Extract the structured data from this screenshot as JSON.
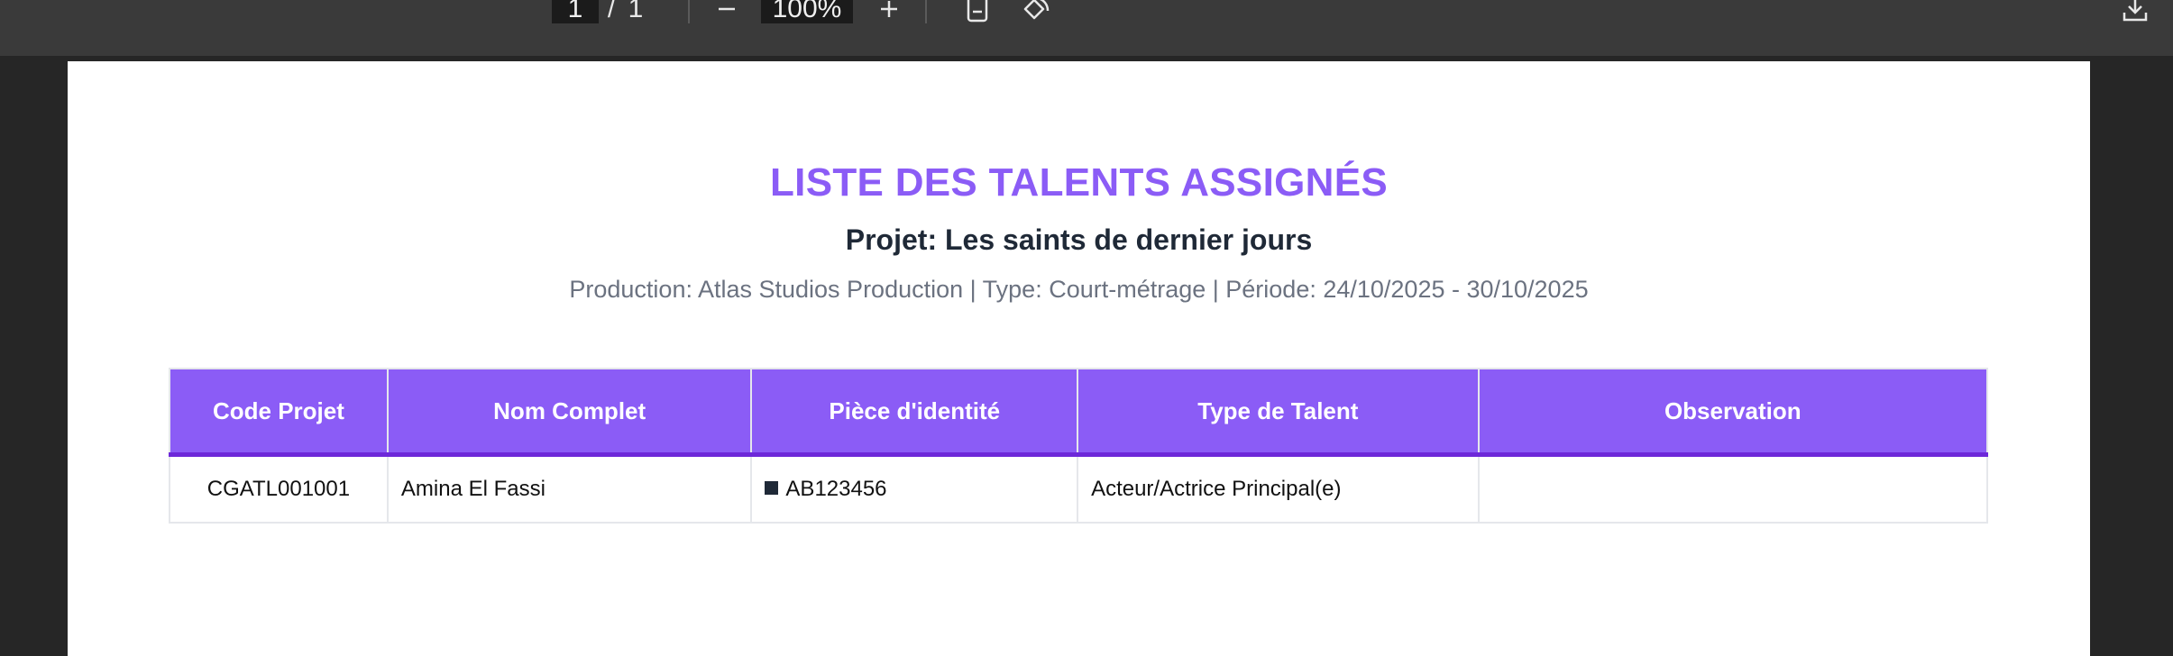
{
  "toolbar": {
    "current_page": "1",
    "page_separator": "/",
    "total_pages": "1",
    "zoom": "100%",
    "icons": [
      "minus-icon",
      "plus-icon",
      "fit-page-icon",
      "rotate-icon",
      "download-icon"
    ]
  },
  "document": {
    "title": "LISTE DES TALENTS ASSIGNÉS",
    "subtitle": "Projet: Les saints de dernier jours",
    "meta": "Production: Atlas Studios Production | Type: Court-métrage | Période: 24/10/2025 - 30/10/2025",
    "table": {
      "headers": [
        "Code Projet",
        "Nom Complet",
        "Pièce d'identité",
        "Type de Talent",
        "Observation"
      ],
      "rows": [
        [
          "CGATL001001",
          "Amina El Fassi",
          "AB123456",
          "Acteur/Actrice Principal(e)",
          ""
        ]
      ]
    }
  },
  "colors": {
    "accent": "#8b5cf6",
    "header_border": "#6d28d9",
    "toolbar_bg": "#3a3a3a",
    "viewer_bg": "#262626"
  }
}
